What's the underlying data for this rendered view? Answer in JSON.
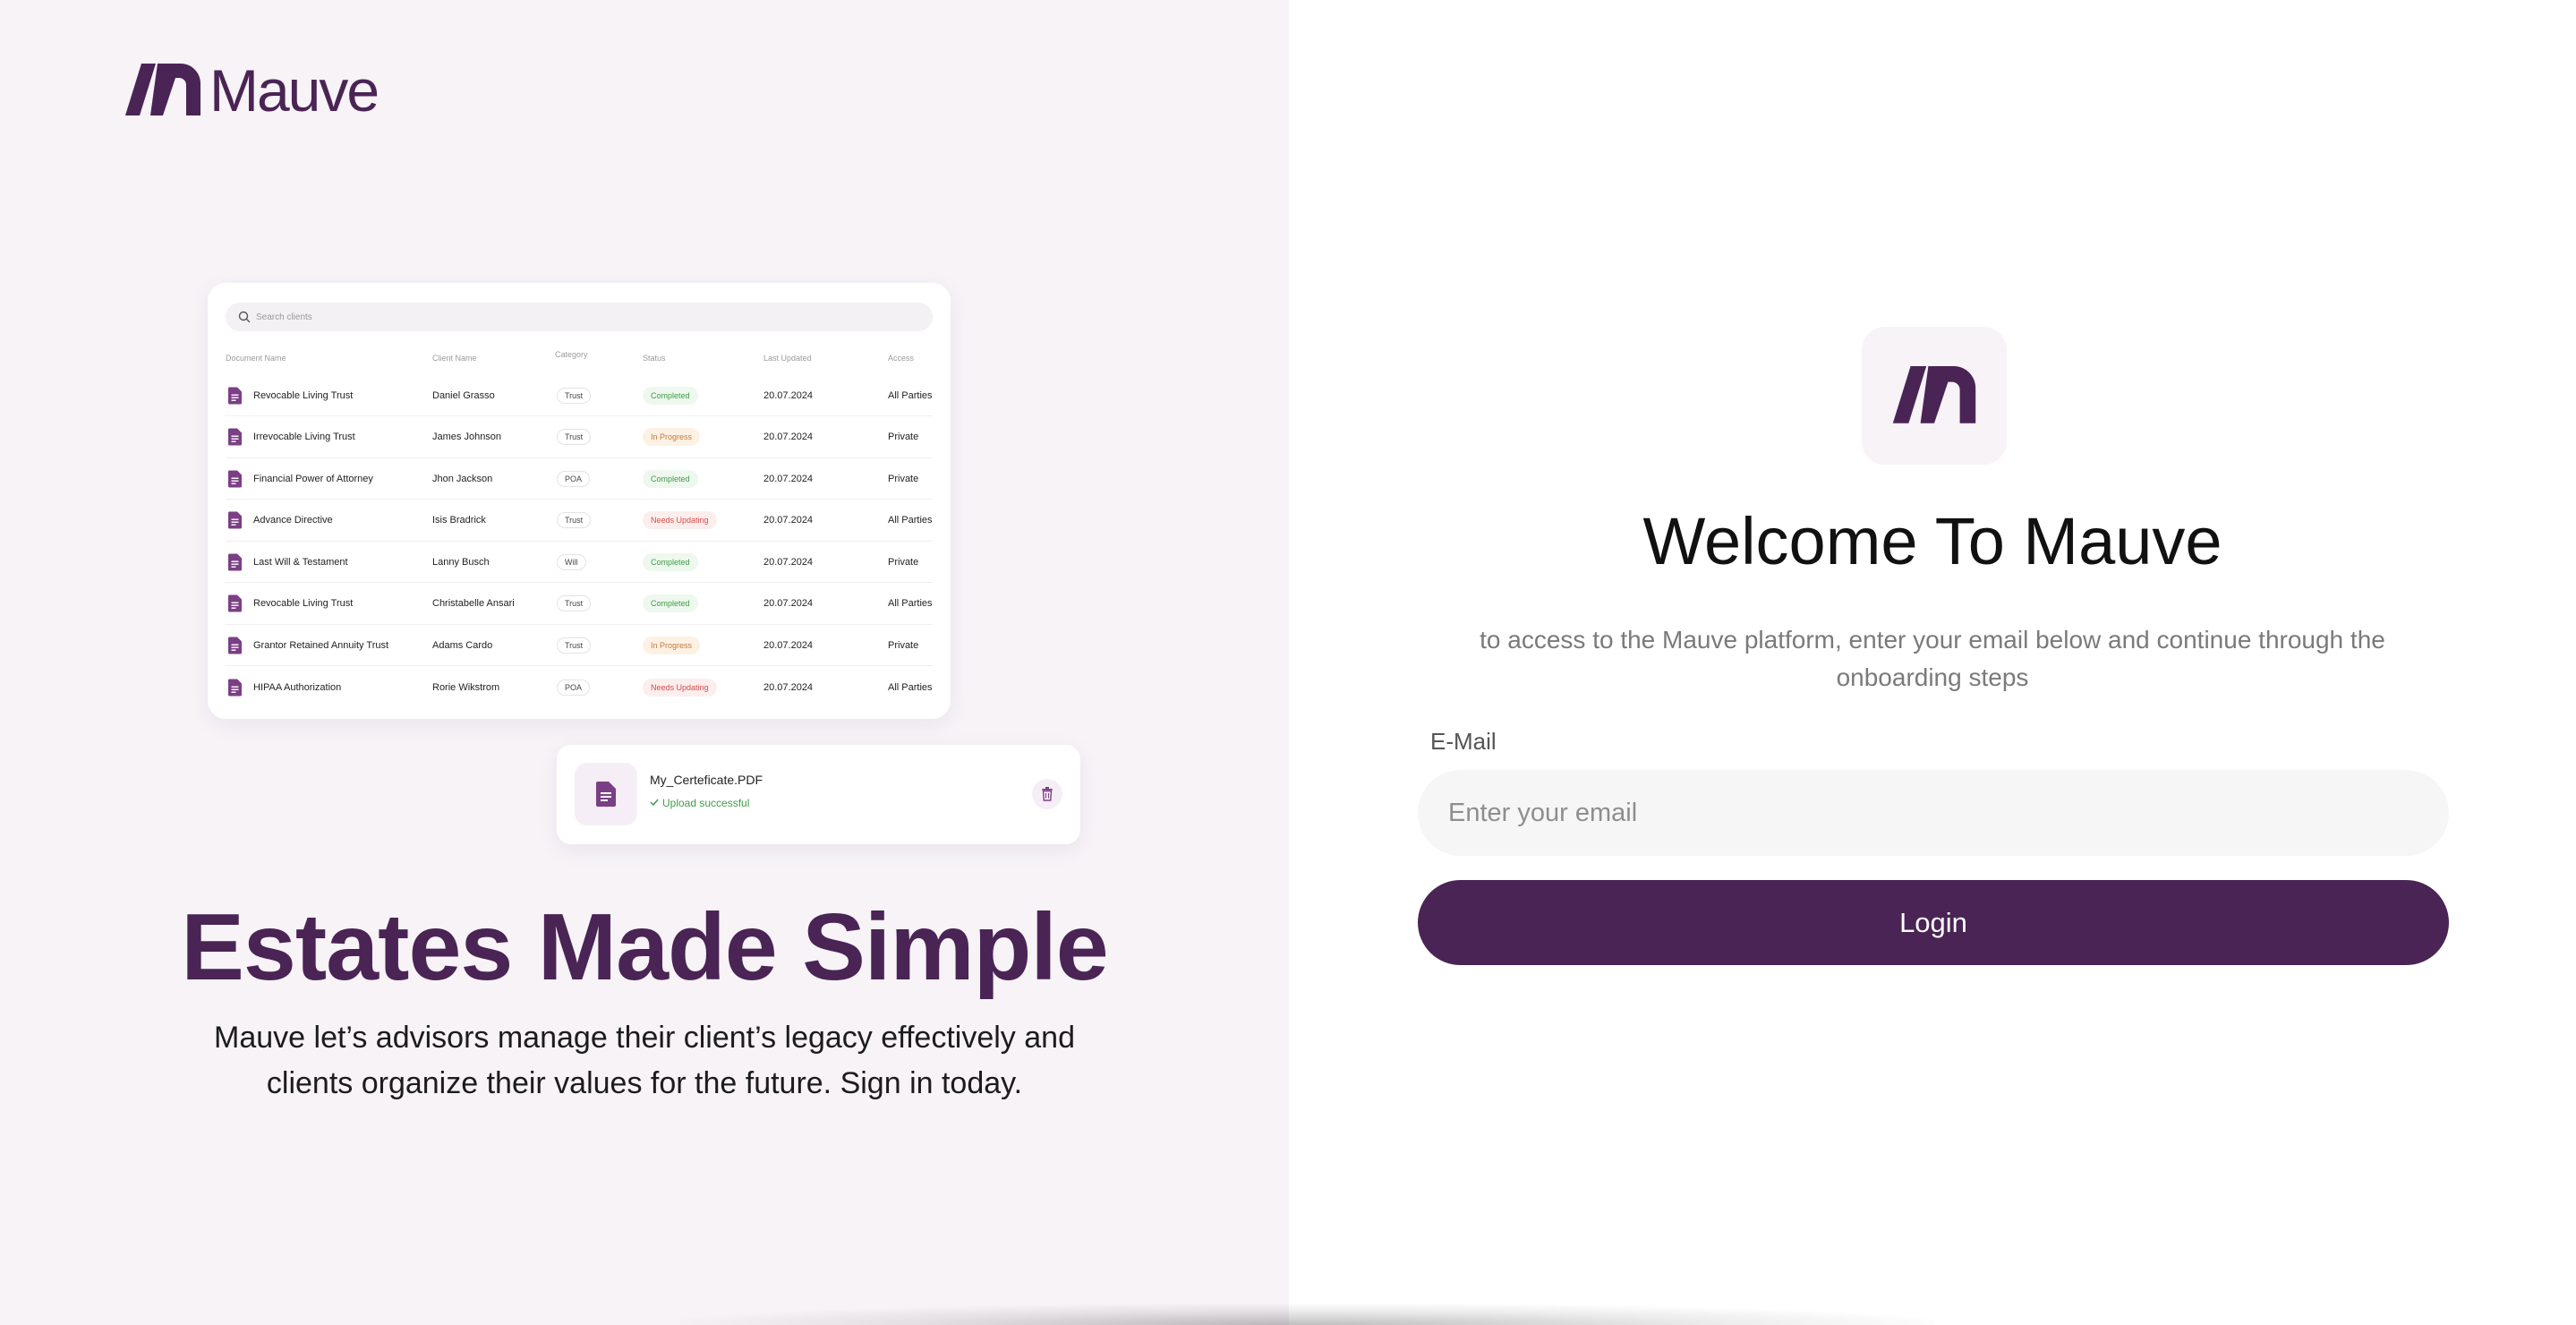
{
  "brand": {
    "name": "Mauve"
  },
  "colors": {
    "brand": "#4a2455",
    "left_bg": "#f7f3f7",
    "completed": "#3f9d47",
    "in_progress": "#c47b33",
    "needs_updating": "#d34c4c"
  },
  "table": {
    "search_placeholder": "Search clients",
    "columns": [
      "Document Name",
      "Client Name",
      "Category",
      "Status",
      "Last Updated",
      "Access"
    ],
    "rows": [
      {
        "doc": "Revocable Living Trust",
        "client": "Daniel Grasso",
        "category": "Trust",
        "status": "Completed",
        "updated": "20.07.2024",
        "access": "All Parties"
      },
      {
        "doc": "Irrevocable Living Trust",
        "client": "James Johnson",
        "category": "Trust",
        "status": "In Progress",
        "updated": "20.07.2024",
        "access": "Private"
      },
      {
        "doc": "Financial Power of Attorney",
        "client": "Jhon Jackson",
        "category": "POA",
        "status": "Completed",
        "updated": "20.07.2024",
        "access": "Private"
      },
      {
        "doc": "Advance Directive",
        "client": "Isis Bradrick",
        "category": "Trust",
        "status": "Needs Updating",
        "updated": "20.07.2024",
        "access": "All Parties"
      },
      {
        "doc": "Last Will & Testament",
        "client": "Lanny Busch",
        "category": "Will",
        "status": "Completed",
        "updated": "20.07.2024",
        "access": "Private"
      },
      {
        "doc": "Revocable Living Trust",
        "client": "Christabelle Ansari",
        "category": "Trust",
        "status": "Completed",
        "updated": "20.07.2024",
        "access": "All Parties"
      },
      {
        "doc": "Grantor Retained Annuity Trust",
        "client": "Adams Cardo",
        "category": "Trust",
        "status": "In Progress",
        "updated": "20.07.2024",
        "access": "Private"
      },
      {
        "doc": "HIPAA Authorization",
        "client": "Rorie Wikstrom",
        "category": "POA",
        "status": "Needs Updating",
        "updated": "20.07.2024",
        "access": "All Parties"
      }
    ]
  },
  "upload": {
    "filename": "My_Certeficate.PDF",
    "status": "Upload successful"
  },
  "hero": {
    "headline": "Estates Made Simple",
    "subline": "Mauve let’s advisors manage their client’s legacy effectively and clients organize their values for the future. Sign in today."
  },
  "login": {
    "title": "Welcome To Mauve",
    "intro": "to access to the Mauve platform, enter your email below and continue through the onboarding steps",
    "email_label": "E-Mail",
    "email_placeholder": "Enter your email",
    "email_value": "",
    "button": "Login"
  }
}
